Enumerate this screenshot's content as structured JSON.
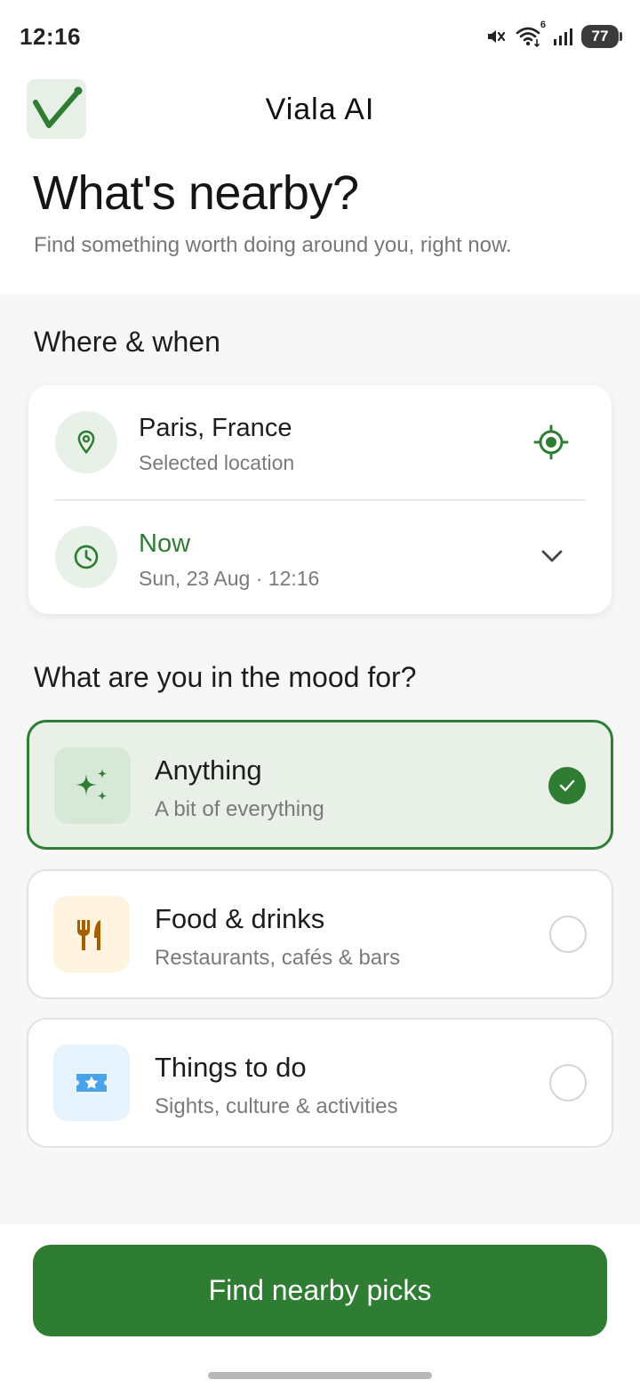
{
  "status_bar": {
    "time": "12:16",
    "battery": "77",
    "wifi_badge": "6"
  },
  "header": {
    "app_title": "Viala AI"
  },
  "hero": {
    "title": "What's nearby?",
    "subtitle": "Find something worth doing around you, right now."
  },
  "where_when": {
    "heading": "Where & when",
    "location": {
      "title": "Paris, France",
      "subtitle": "Selected location",
      "icon": "map-pin-icon",
      "action_icon": "my-location-icon"
    },
    "time": {
      "title": "Now",
      "subtitle": "Sun, 23 Aug · 12:16",
      "icon": "clock-icon",
      "action_icon": "chevron-down-icon"
    }
  },
  "mood": {
    "heading": "What are you in the mood for?",
    "options": [
      {
        "title": "Anything",
        "subtitle": "A bit of everything",
        "icon": "sparkles-icon",
        "selected": true
      },
      {
        "title": "Food & drinks",
        "subtitle": "Restaurants, cafés & bars",
        "icon": "utensils-icon",
        "selected": false
      },
      {
        "title": "Things to do",
        "subtitle": "Sights, culture & activities",
        "icon": "ticket-icon",
        "selected": false
      }
    ]
  },
  "cta": {
    "label": "Find nearby picks"
  },
  "colors": {
    "accent": "#2e7d32",
    "accent_light": "#e8f0e8",
    "food_tile": "#fff4e0",
    "food_icon": "#a65f00",
    "activity_tile": "#e6f3fc",
    "activity_icon": "#4aa3e8"
  }
}
